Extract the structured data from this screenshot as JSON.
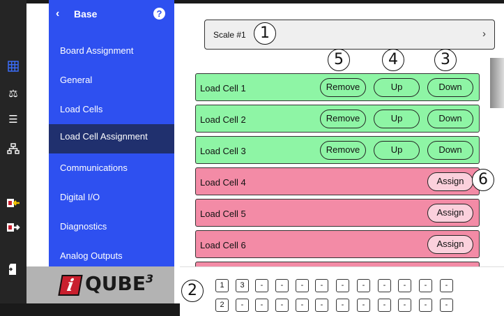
{
  "rail": {
    "icons": [
      "grid-icon",
      "scale-icon",
      "list-icon",
      "network-icon",
      "import-icon",
      "export-icon",
      "file-icon"
    ]
  },
  "menu": {
    "back_glyph": "‹",
    "title": "Base",
    "help_glyph": "?",
    "items": [
      {
        "label": "Board Assignment"
      },
      {
        "label": "General"
      },
      {
        "label": "Load Cells"
      },
      {
        "label": "Load Cell Assignment",
        "active": true
      },
      {
        "label": "Communications"
      },
      {
        "label": "Digital I/O"
      },
      {
        "label": "Diagnostics"
      },
      {
        "label": "Analog Outputs"
      }
    ]
  },
  "logo": {
    "text": "QUBE",
    "superscript": "3"
  },
  "scale": {
    "label": "Scale #1",
    "chevron": "›"
  },
  "load_cells": [
    {
      "label": "Load Cell 1",
      "status": "assigned",
      "buttons": [
        "Remove",
        "Up",
        "Down"
      ]
    },
    {
      "label": "Load Cell 2",
      "status": "assigned",
      "buttons": [
        "Remove",
        "Up",
        "Down"
      ]
    },
    {
      "label": "Load Cell 3",
      "status": "assigned",
      "buttons": [
        "Remove",
        "Up",
        "Down"
      ]
    },
    {
      "label": "Load Cell 4",
      "status": "unassigned",
      "buttons": [
        "Assign"
      ]
    },
    {
      "label": "Load Cell 5",
      "status": "unassigned",
      "buttons": [
        "Assign"
      ]
    },
    {
      "label": "Load Cell 6",
      "status": "unassigned",
      "buttons": [
        "Assign"
      ]
    }
  ],
  "pager": {
    "row1": [
      "1",
      "3",
      "-",
      "-",
      "-",
      "-",
      "-",
      "-",
      "-",
      "-",
      "-",
      "-"
    ],
    "row2": [
      "2",
      "-",
      "-",
      "-",
      "-",
      "-",
      "-",
      "-",
      "-",
      "-",
      "-",
      "-"
    ]
  },
  "callouts": [
    "1",
    "2",
    "3",
    "4",
    "5",
    "6"
  ],
  "colors": {
    "menu_bg": "#2e50f0",
    "menu_active": "#20306e",
    "assigned": "#8ef5a5",
    "unassigned": "#f38ba6",
    "rail": "#252525"
  }
}
